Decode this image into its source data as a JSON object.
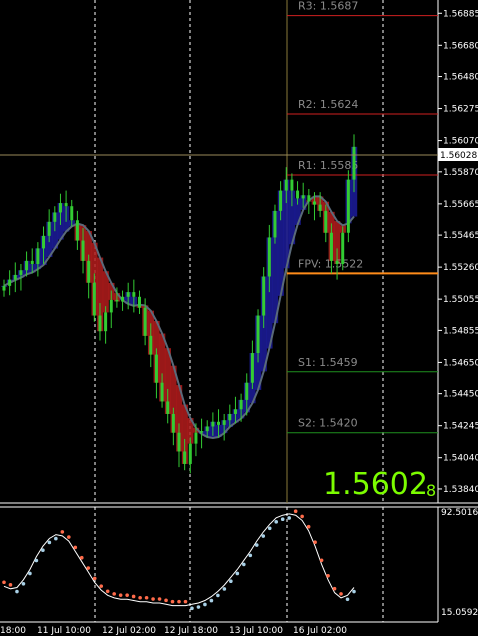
{
  "chart_data": [
    {
      "type": "candlestick",
      "name": "main",
      "price_ticks": [
        "1.56885",
        "1.56680",
        "1.56480",
        "1.56275",
        "1.56070",
        "1.55870",
        "1.55665",
        "1.55465",
        "1.55260",
        "1.55055",
        "1.54855",
        "1.54650",
        "1.54450",
        "1.54245",
        "1.54040",
        "1.53840"
      ],
      "price_range": [
        1.5375,
        1.5697
      ],
      "current_price": "1.56028",
      "big_price": "1.5602",
      "big_price_small": "8",
      "pivot_levels": [
        {
          "label": "R3:",
          "value": "1.5687",
          "price": 1.5687,
          "color": "#d02020"
        },
        {
          "label": "R2:",
          "value": "1.5624",
          "price": 1.5624,
          "color": "#d02020"
        },
        {
          "label": "R1:",
          "value": "1.5585",
          "price": 1.5585,
          "color": "#d02020"
        },
        {
          "label": "FPV:",
          "value": "1.5522",
          "price": 1.5522,
          "color": "#ff8c1a"
        },
        {
          "label": "S1:",
          "value": "1.5459",
          "price": 1.5459,
          "color": "#1f8f1f"
        },
        {
          "label": "S2:",
          "value": "1.5420",
          "price": 1.542,
          "color": "#1f8f1f"
        }
      ],
      "candles_close": [
        1.5514,
        1.5518,
        1.5521,
        1.5524,
        1.553,
        1.5528,
        1.5538,
        1.5546,
        1.5555,
        1.5561,
        1.5567,
        1.5565,
        1.5556,
        1.5543,
        1.553,
        1.5516,
        1.5495,
        1.5485,
        1.5497,
        1.5505,
        1.5504,
        1.5507,
        1.551,
        1.5507,
        1.55,
        1.5482,
        1.547,
        1.5452,
        1.544,
        1.5432,
        1.542,
        1.5408,
        1.54,
        1.5413,
        1.542,
        1.5421,
        1.5424,
        1.5427,
        1.5425,
        1.5428,
        1.5432,
        1.5435,
        1.5441,
        1.5452,
        1.5471,
        1.5495,
        1.552,
        1.5545,
        1.5562,
        1.5575,
        1.5582,
        1.5575,
        1.557,
        1.5572,
        1.5568,
        1.5566,
        1.5562,
        1.5548,
        1.553,
        1.5528,
        1.5548,
        1.5582,
        1.5603
      ]
    },
    {
      "type": "line",
      "name": "oscillator",
      "y_ticks": [
        "92.5016",
        "15.0592"
      ],
      "y_range": [
        15.0592,
        92.5016
      ],
      "x_ticks": [
        "18:00",
        "11 Jul 10:00",
        "12 Jul 02:00",
        "12 Jul 18:00",
        "13 Jul 10:00",
        "16 Jul 02:00"
      ],
      "values": [
        35,
        33,
        34,
        40,
        48,
        58,
        66,
        72,
        75,
        74,
        70,
        62,
        54,
        46,
        38,
        32,
        28,
        26,
        25,
        25,
        24,
        23,
        23,
        22,
        22,
        21,
        20,
        20,
        20,
        21,
        22,
        24,
        27,
        31,
        36,
        42,
        48,
        55,
        62,
        70,
        77,
        83,
        88,
        90,
        91,
        90,
        86,
        78,
        66,
        52,
        40,
        30,
        26,
        28,
        34
      ]
    }
  ]
}
